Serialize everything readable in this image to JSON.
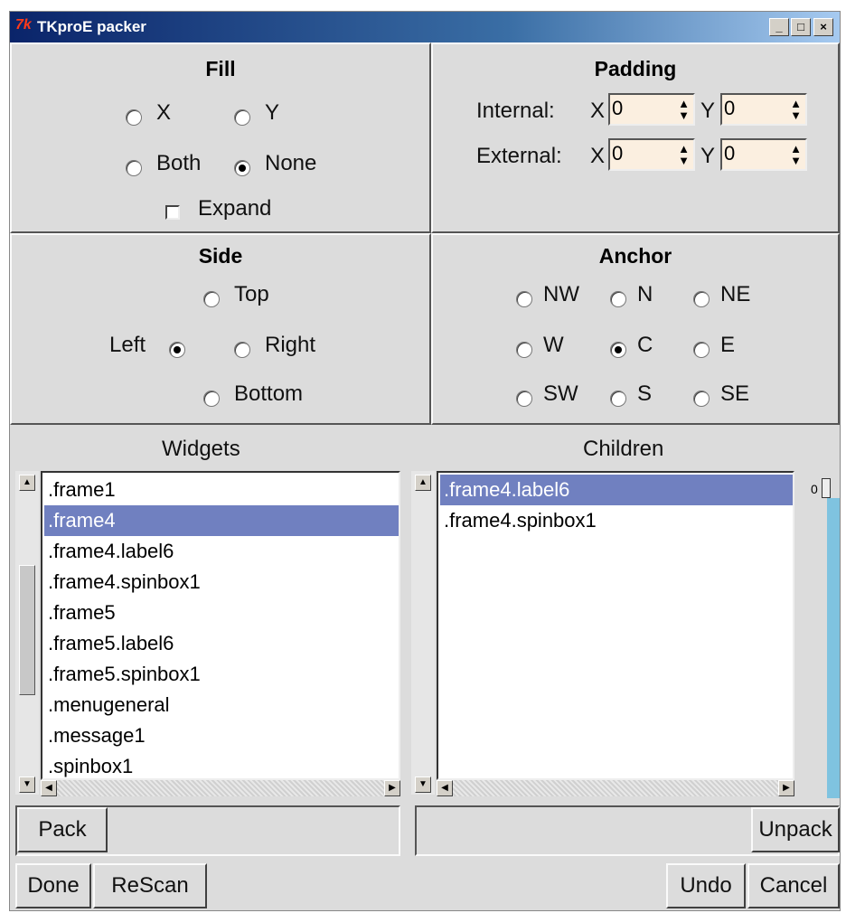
{
  "window": {
    "title": "TKproE packer",
    "logo": "7k",
    "controls": [
      "_",
      "□",
      "×"
    ]
  },
  "fill": {
    "title": "Fill",
    "options": [
      "X",
      "Y",
      "Both",
      "None"
    ],
    "selected": "None",
    "expand_label": "Expand",
    "expand_checked": false
  },
  "padding": {
    "title": "Padding",
    "internal_label": "Internal:",
    "external_label": "External:",
    "x_label": "X",
    "y_label": "Y",
    "internal_x": "0",
    "internal_y": "0",
    "external_x": "0",
    "external_y": "0"
  },
  "side": {
    "title": "Side",
    "options": [
      "Top",
      "Left",
      "Right",
      "Bottom"
    ],
    "selected": "Left"
  },
  "anchor": {
    "title": "Anchor",
    "options": [
      "NW",
      "N",
      "NE",
      "W",
      "C",
      "E",
      "SW",
      "S",
      "SE"
    ],
    "selected": "C"
  },
  "widgets": {
    "title": "Widgets",
    "items": [
      ".frame1",
      ".frame4",
      ".frame4.label6",
      ".frame4.spinbox1",
      ".frame5",
      ".frame5.label6",
      ".frame5.spinbox1",
      ".menugeneral",
      ".message1",
      ".spinbox1"
    ],
    "selected_index": 1
  },
  "children": {
    "title": "Children",
    "items": [
      ".frame4.label6",
      ".frame4.spinbox1"
    ],
    "selected_index": 0
  },
  "scale": {
    "value_label": "0",
    "color": "#7fc3e0"
  },
  "buttons": {
    "pack": "Pack",
    "unpack": "Unpack",
    "done": "Done",
    "rescan": "ReScan",
    "undo": "Undo",
    "cancel": "Cancel"
  }
}
